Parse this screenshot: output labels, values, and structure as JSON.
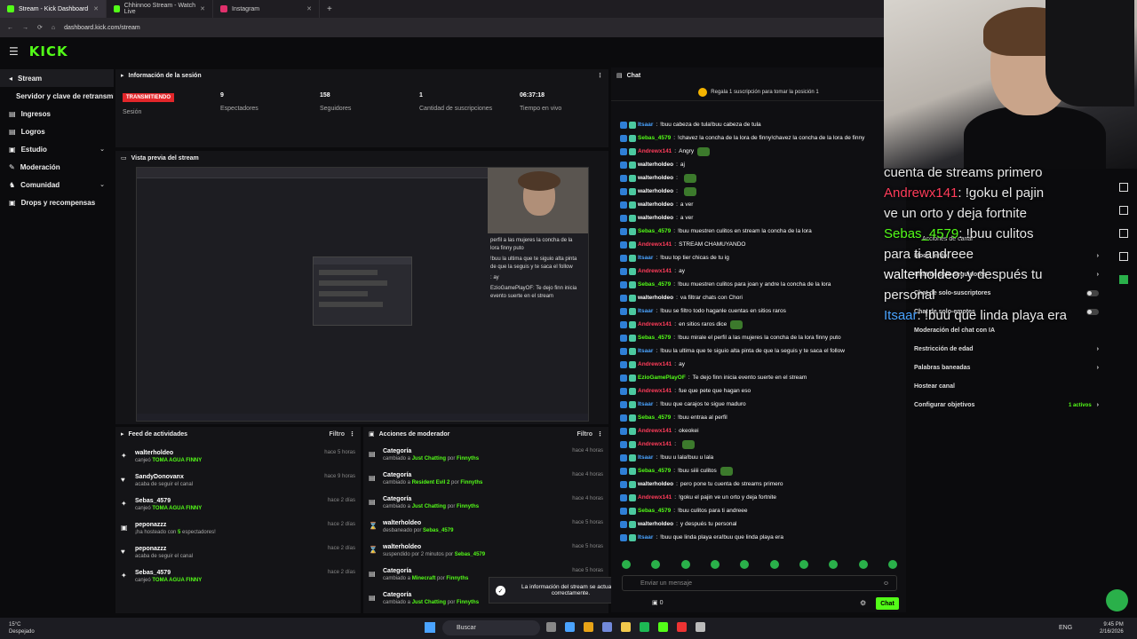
{
  "browser": {
    "tabs": [
      {
        "label": "Stream - Kick Dashboard",
        "color": "#53fc18",
        "active": true
      },
      {
        "label": "Chhinnoo Stream - Watch Live",
        "color": "#53fc18",
        "active": false
      },
      {
        "label": "Instagram",
        "color": "#e1306c",
        "active": false
      }
    ],
    "url": "dashboard.kick.com/stream"
  },
  "app": {
    "logo": "KICK"
  },
  "sidebar": {
    "items": [
      {
        "label": "Stream"
      },
      {
        "label": "Servidor y clave de retransmisión"
      },
      {
        "label": "Ingresos"
      },
      {
        "label": "Logros"
      },
      {
        "label": "Estudio"
      },
      {
        "label": "Moderación"
      },
      {
        "label": "Comunidad"
      },
      {
        "label": "Drops y recompensas"
      }
    ]
  },
  "session": {
    "title": "Información de la sesión",
    "live_label": "TRANSMITIENDO",
    "session_label": "Sesión",
    "stats": [
      {
        "value": "9",
        "label": "Espectadores"
      },
      {
        "value": "158",
        "label": "Seguidores"
      },
      {
        "value": "1",
        "label": "Cantidad de suscripciones"
      },
      {
        "value": "06:37:18",
        "label": "Tiempo en vivo"
      }
    ]
  },
  "preview": {
    "title": "Vista previa del stream",
    "chat_lines": [
      "perfil a las mujeres la concha de la lora finny puto",
      "!buu la ultima que te siguio alta pinta de que la seguis y te saca el follow",
      ": ay",
      "EzioGamePlayOF: Te dejo finn inicia evento suerte en el stream"
    ]
  },
  "activity": {
    "title": "Feed de actividades",
    "filter": "Filtro",
    "rows": [
      {
        "user": "walterholdeo",
        "pre": "canjeó ",
        "hl": "TOMA AGUA FINNY",
        "post": "",
        "time": "hace 5 horas",
        "icon": "gift"
      },
      {
        "user": "SandyDonovanx",
        "pre": "acaba de seguir el canal",
        "hl": "",
        "post": "",
        "time": "hace 9 horas",
        "icon": "heart"
      },
      {
        "user": "Sebas_4579",
        "pre": "canjeó ",
        "hl": "TOMA AGUA FINNY",
        "post": "",
        "time": "hace 2 días",
        "icon": "gift"
      },
      {
        "user": "peponazzz",
        "pre": "¡ha hosteado con ",
        "hl": "5",
        "post": " espectadores!",
        "time": "hace 2 días",
        "icon": "host"
      },
      {
        "user": "peponazzz",
        "pre": "acaba de seguir el canal",
        "hl": "",
        "post": "",
        "time": "hace 2 días",
        "icon": "heart"
      },
      {
        "user": "Sebas_4579",
        "pre": "canjeó ",
        "hl": "TOMA AGUA FINNY",
        "post": "",
        "time": "hace 2 días",
        "icon": "gift"
      }
    ]
  },
  "modactions": {
    "title": "Acciones de moderador",
    "filter": "Filtro",
    "rows": [
      {
        "title": "Categoría",
        "pre": "cambiado a ",
        "hl": "Just Chatting",
        "mid": " por ",
        "by": "Finnyths",
        "time": "hace 4 horas"
      },
      {
        "title": "Categoría",
        "pre": "cambiado a ",
        "hl": "Resident Evil 2",
        "mid": " por ",
        "by": "Finnyths",
        "time": "hace 4 horas"
      },
      {
        "title": "Categoría",
        "pre": "cambiado a ",
        "hl": "Just Chatting",
        "mid": " por ",
        "by": "Finnyths",
        "time": "hace 4 horas"
      },
      {
        "title": "walterholdeo",
        "pre": "desbaneado por ",
        "hl": "",
        "mid": "",
        "by": "Sebas_4579",
        "time": "hace 5 horas"
      },
      {
        "title": "walterholdeo",
        "pre": "suspendido por 2 minutos por ",
        "hl": "",
        "mid": "",
        "by": "Sebas_4579",
        "time": "hace 5 horas"
      },
      {
        "title": "Categoría",
        "pre": "cambiado a ",
        "hl": "Minecraft",
        "mid": " por ",
        "by": "Finnyths",
        "time": "hace 5 horas"
      },
      {
        "title": "Categoría",
        "pre": "cambiado a ",
        "hl": "Just Chatting",
        "mid": " por ",
        "by": "Finnyths",
        "time": "hace 5 horas"
      }
    ]
  },
  "toast": "La información del stream se actualizó correctamente.",
  "chat": {
    "title": "Chat",
    "promo": "Regala 1 suscripción para tomar la posición 1",
    "messages": [
      {
        "u": "Itsaar",
        "c": "#4aa3ff",
        "m": "!buu cabeza de tula!buu cabeza de tula"
      },
      {
        "u": "Sebas_4579",
        "c": "#53fc18",
        "m": "!chavez la concha de la lora de finny!chavez la concha de la lora de finny"
      },
      {
        "u": "Andrewx141",
        "c": "#ff3c5a",
        "m": "Angry",
        "e": true
      },
      {
        "u": "walterholdeo",
        "c": "#ffffff",
        "m": "aj"
      },
      {
        "u": "walterholdeo",
        "c": "#ffffff",
        "m": "",
        "e": true
      },
      {
        "u": "walterholdeo",
        "c": "#ffffff",
        "m": "",
        "e": true
      },
      {
        "u": "walterholdeo",
        "c": "#ffffff",
        "m": "a ver"
      },
      {
        "u": "walterholdeo",
        "c": "#ffffff",
        "m": "a ver"
      },
      {
        "u": "Sebas_4579",
        "c": "#53fc18",
        "m": "!buu muestren culitos en stream la concha de la lora"
      },
      {
        "u": "Andrewx141",
        "c": "#ff3c5a",
        "m": "STREAM CHAMUYANDO"
      },
      {
        "u": "Itsaar",
        "c": "#4aa3ff",
        "m": "!buu top tier chicas de tu ig"
      },
      {
        "u": "Andrewx141",
        "c": "#ff3c5a",
        "m": "ay"
      },
      {
        "u": "Sebas_4579",
        "c": "#53fc18",
        "m": "!buu muestren culitos para joan y andre la concha de la lora"
      },
      {
        "u": "walterholdeo",
        "c": "#ffffff",
        "m": "va filtrar chats con Chori"
      },
      {
        "u": "Itsaar",
        "c": "#4aa3ff",
        "m": "!buu se filtro todo haganle cuentas en sitios raros"
      },
      {
        "u": "Andrewx141",
        "c": "#ff3c5a",
        "m": "en sitios raros dice",
        "e": true
      },
      {
        "u": "Sebas_4579",
        "c": "#53fc18",
        "m": "!buu mirale el perfil a las mujeres la concha de la lora finny puto"
      },
      {
        "u": "Itsaar",
        "c": "#4aa3ff",
        "m": "!buu la ultima que te siguio alta pinta de que la seguis y te saca el follow"
      },
      {
        "u": "Andrewx141",
        "c": "#ff3c5a",
        "m": "ay"
      },
      {
        "u": "EzioGamePlayOF",
        "c": "#53fc18",
        "m": "Te dejo finn inicia evento suerte en el stream"
      },
      {
        "u": "Andrewx141",
        "c": "#ff3c5a",
        "m": "fue que pete que hagan eso"
      },
      {
        "u": "Itsaar",
        "c": "#4aa3ff",
        "m": "!buu que carajos te sigue maduro"
      },
      {
        "u": "Sebas_4579",
        "c": "#53fc18",
        "m": "!buu entraa al perfil"
      },
      {
        "u": "Andrewx141",
        "c": "#ff3c5a",
        "m": "okeokei"
      },
      {
        "u": "Andrewx141",
        "c": "#ff3c5a",
        "m": "",
        "e": true
      },
      {
        "u": "Itsaar",
        "c": "#4aa3ff",
        "m": "!buu u lala!buu u lala"
      },
      {
        "u": "Sebas_4579",
        "c": "#53fc18",
        "m": "!buu siiii culitos",
        "e": true
      },
      {
        "u": "walterholdeo",
        "c": "#ffffff",
        "m": "pero pone tu cuenta de streams primero"
      },
      {
        "u": "Andrewx141",
        "c": "#ff3c5a",
        "m": "!goku el pajin ve un orto y deja fortnite"
      },
      {
        "u": "Sebas_4579",
        "c": "#53fc18",
        "m": "!buu culitos para ti andreee"
      },
      {
        "u": "walterholdeo",
        "c": "#ffffff",
        "m": "y después tu personal"
      },
      {
        "u": "Itsaar",
        "c": "#4aa3ff",
        "m": "!buu que linda playa era!buu que linda playa era"
      }
    ],
    "input_placeholder": "Enviar un mensaje",
    "points": "0",
    "send_label": "Chat"
  },
  "overlay": {
    "lines": [
      {
        "u": "",
        "c": "#ffffff",
        "m": "cuenta de streams primero"
      },
      {
        "u": "Andrewx141",
        "c": "#ff3c5a",
        "m": "!goku el pajin"
      },
      {
        "u": "",
        "c": "#ffffff",
        "m": "ve un orto y deja fortnite"
      },
      {
        "u": "Sebas_4579",
        "c": "#53fc18",
        "m": "!buu culitos"
      },
      {
        "u": "",
        "c": "#ffffff",
        "m": "para ti andreee"
      },
      {
        "u": "walterholdeo",
        "c": "#ffffff",
        "m": "y después tu"
      },
      {
        "u": "",
        "c": "#ffffff",
        "m": "personal"
      },
      {
        "u": "Itsaar",
        "c": "#4aa3ff",
        "m": "!buu que linda playa era"
      }
    ]
  },
  "settings": {
    "title": "Acciones de canal",
    "rows": [
      {
        "label": "Modo lento",
        "ctl": "chevron"
      },
      {
        "label": "Chat de solo-seguidores",
        "ctl": "chevron"
      },
      {
        "label": "Chat de solo-suscriptores",
        "ctl": "toggle"
      },
      {
        "label": "Chat de solo-emotes",
        "ctl": "toggle"
      },
      {
        "label": "Moderación del chat con IA",
        "ctl": "none"
      },
      {
        "label": "Restricción de edad",
        "ctl": "chevron"
      },
      {
        "label": "Palabras baneadas",
        "ctl": "chevron"
      },
      {
        "label": "Hostear canal",
        "ctl": "none"
      },
      {
        "label": "Configurar objetivos",
        "ctl": "chevron",
        "extra": "1 activos"
      }
    ]
  },
  "taskbar": {
    "weather_temp": "15°C",
    "weather_desc": "Despejado",
    "search": "Buscar",
    "lang": "ENG",
    "time": "9:45 PM",
    "date": "2/16/2026"
  }
}
